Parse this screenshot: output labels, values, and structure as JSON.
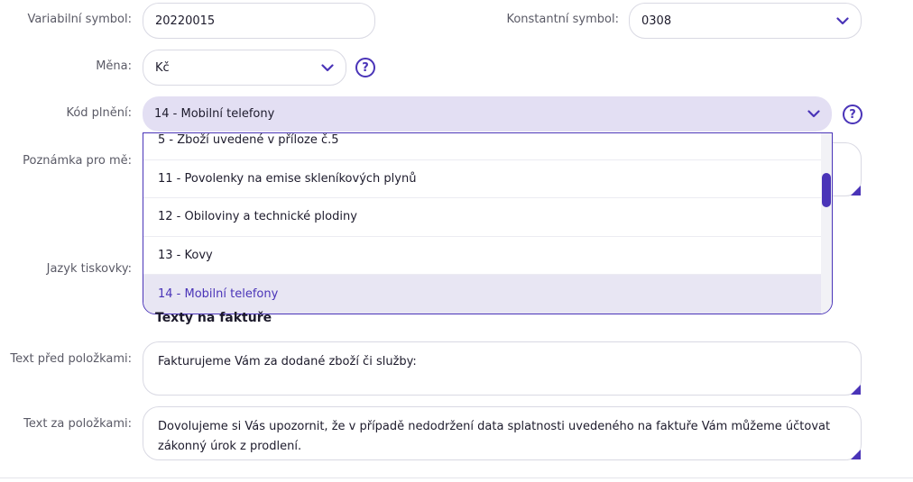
{
  "form": {
    "variable_symbol": {
      "label": "Variabilní symbol:",
      "value": "20220015"
    },
    "constant_symbol": {
      "label": "Konstantní symbol:",
      "value": "0308"
    },
    "currency": {
      "label": "Měna:",
      "value": "Kč"
    },
    "fulfillment_code": {
      "label": "Kód plnění:",
      "value": "14 - Mobilní telefony",
      "options": [
        "5 - Zboží uvedené v příloze č.5",
        "11 - Povolenky na emise skleníkových plynů",
        "12 - Obiloviny a technické plodiny",
        "13 - Kovy",
        "14 - Mobilní telefony"
      ]
    },
    "note": {
      "label": "Poznámka pro mě:"
    },
    "print_language": {
      "label": "Jazyk tiskovky:"
    },
    "help_glyph": "?"
  },
  "invoice_texts": {
    "title": "Texty na faktuře",
    "before_items": {
      "label": "Text před položkami:",
      "value": "Fakturujeme Vám za dodané zboží či služby:"
    },
    "after_items": {
      "label": "Text za položkami:",
      "value": "Dovolujeme si Vás upozornit, že v případě nedodržení data splatnosti uvedeného na faktuře Vám můžeme účtovat zákonný úrok z prodlení."
    }
  },
  "colors": {
    "accent": "#4a34b8",
    "selected_bg": "#e3dff3",
    "border": "#d9d9e3"
  },
  "icons": {
    "dropdown": "chevron-down-icon",
    "help": "help-circle-icon",
    "resize": "resize-handle-icon"
  }
}
